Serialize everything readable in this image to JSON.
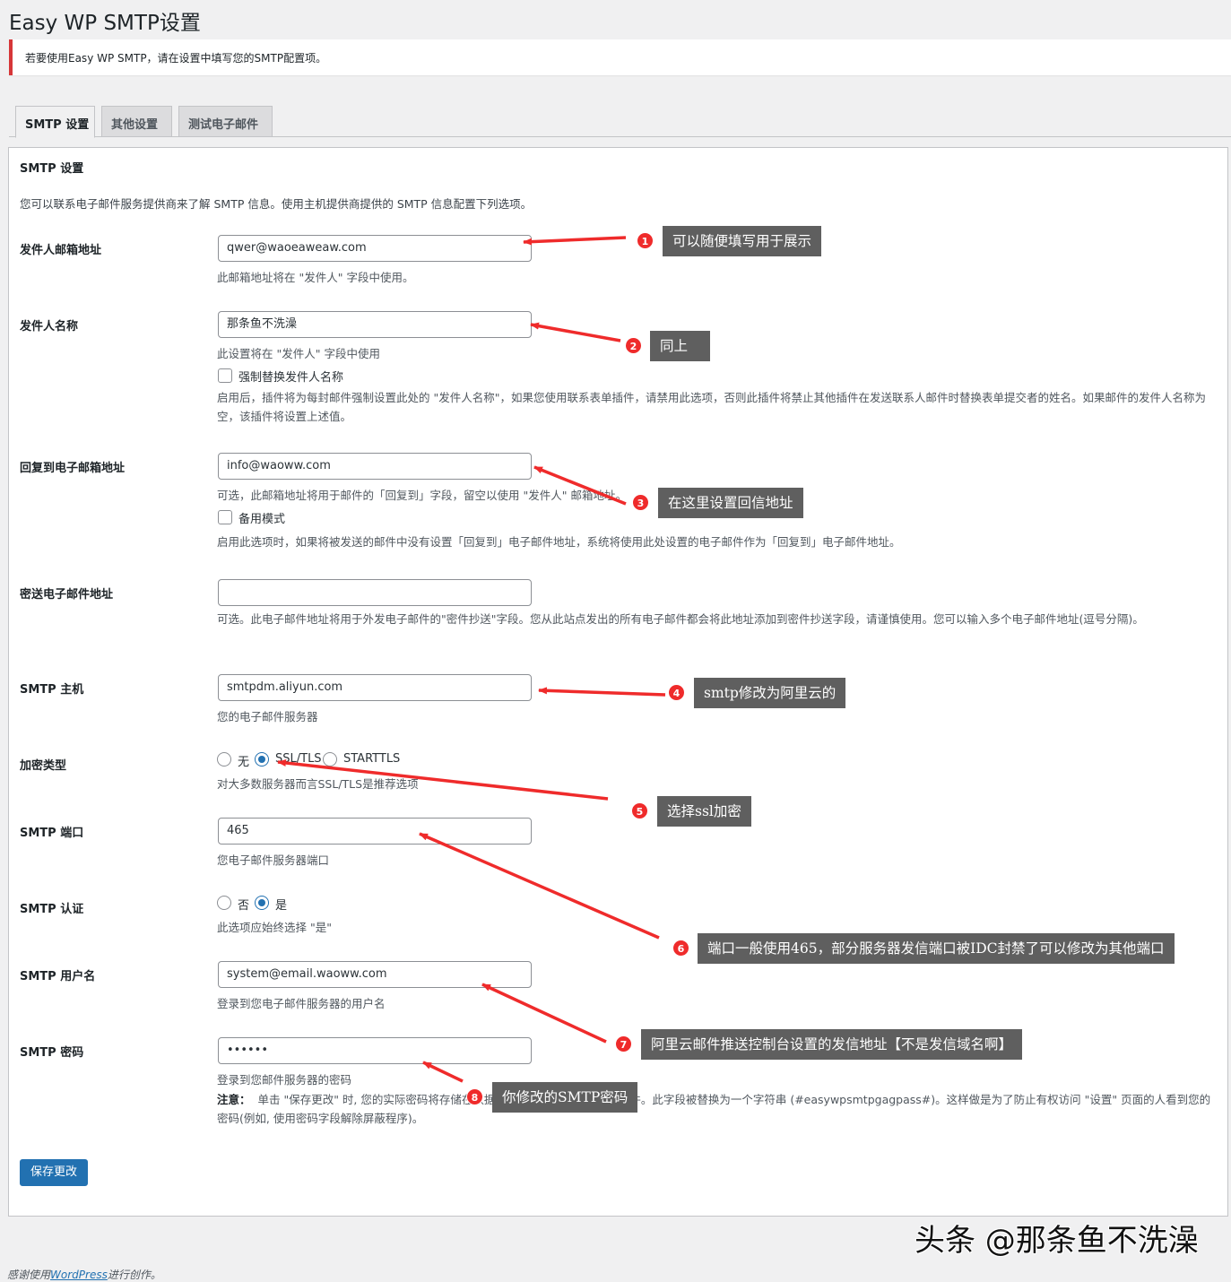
{
  "page": {
    "title": "Easy WP SMTP设置"
  },
  "notice": {
    "text": "若要使用Easy WP SMTP，请在设置中填写您的SMTP配置项。"
  },
  "tabs": [
    {
      "label": "SMTP 设置"
    },
    {
      "label": "其他设置"
    },
    {
      "label": "测试电子邮件"
    }
  ],
  "section": {
    "title": "SMTP 设置",
    "intro": "您可以联系电子邮件服务提供商来了解 SMTP 信息。使用主机提供商提供的 SMTP 信息配置下列选项。"
  },
  "fields": {
    "from_email": {
      "label": "发件人邮箱地址",
      "value": "qwer@waoeaweaw.com",
      "desc": "此邮箱地址将在 \"发件人\" 字段中使用。"
    },
    "from_name": {
      "label": "发件人名称",
      "value": "那条鱼不洗澡",
      "desc": "此设置将在 \"发件人\" 字段中使用",
      "checkbox_label": "强制替换发件人名称",
      "checkbox_desc": "启用后，插件将为每封邮件强制设置此处的 \"发件人名称\"，如果您使用联系表单插件，请禁用此选项，否则此插件将禁止其他插件在发送联系人邮件时替换表单提交者的姓名。如果邮件的发件人名称为空，该插件将设置上述值。"
    },
    "reply_to": {
      "label": "回复到电子邮箱地址",
      "value": "info@waoww.com",
      "desc": "可选，此邮箱地址将用于邮件的「回复到」字段，留空以使用 \"发件人\" 邮箱地址。",
      "checkbox_label": "备用模式",
      "checkbox_desc": "启用此选项时，如果将被发送的邮件中没有设置「回复到」电子邮件地址，系统将使用此处设置的电子邮件作为「回复到」电子邮件地址。"
    },
    "bcc": {
      "label": "密送电子邮件地址",
      "value": "",
      "desc": "可选。此电子邮件地址将用于外发电子邮件的\"密件抄送\"字段。您从此站点发出的所有电子邮件都会将此地址添加到密件抄送字段，请谨慎使用。您可以输入多个电子邮件地址(逗号分隔)。"
    },
    "host": {
      "label": "SMTP 主机",
      "value": "smtpdm.aliyun.com",
      "desc": "您的电子邮件服务器"
    },
    "encryption": {
      "label": "加密类型",
      "options": [
        "无",
        "SSL/TLS",
        "STARTTLS"
      ],
      "selected": "SSL/TLS",
      "desc": "对大多数服务器而言SSL/TLS是推荐选项"
    },
    "port": {
      "label": "SMTP 端口",
      "value": "465",
      "desc": "您电子邮件服务器端口"
    },
    "auth": {
      "label": "SMTP 认证",
      "options": [
        "否",
        "是"
      ],
      "selected": "是",
      "desc": "此选项应始终选择 \"是\""
    },
    "username": {
      "label": "SMTP 用户名",
      "value": "system@email.waoww.com",
      "desc": "登录到您电子邮件服务器的用户名"
    },
    "password": {
      "label": "SMTP 密码",
      "value": "••••••",
      "desc": "登录到您邮件服务器的密码",
      "note_label": "注意：",
      "note": "单击 \"保存更改\" 时, 您的实际密码将存储在数据库中，然后用于发送电子邮件。此字段被替换为一个字符串 (#easywpsmtpgagpass#)。这样做是为了防止有权访问 \"设置\" 页面的人看到您的密码(例如, 使用密码字段解除屏蔽程序)。"
    }
  },
  "save_button": {
    "label": "保存更改"
  },
  "callouts": [
    {
      "num": "1",
      "text": "可以随便填写用于展示"
    },
    {
      "num": "2",
      "text": "同上"
    },
    {
      "num": "3",
      "text": "在这里设置回信地址"
    },
    {
      "num": "4",
      "text": "smtp修改为阿里云的"
    },
    {
      "num": "5",
      "text": "选择ssl加密"
    },
    {
      "num": "6",
      "text": "端口一般使用465，部分服务器发信端口被IDC封禁了可以修改为其他端口"
    },
    {
      "num": "7",
      "text": "阿里云邮件推送控制台设置的发信地址【不是发信域名啊】"
    },
    {
      "num": "8",
      "text": "你修改的SMTP密码"
    }
  ],
  "watermark": {
    "text": "头条 @那条鱼不洗澡"
  },
  "footer": {
    "prefix": "感谢使用",
    "link": "WordPress",
    "suffix": "进行创作。"
  },
  "colors": {
    "accent": "#2271b1",
    "notice_border": "#d63638",
    "arrow": "#ef2b2b",
    "callout_bg": "#5f5f5f"
  }
}
